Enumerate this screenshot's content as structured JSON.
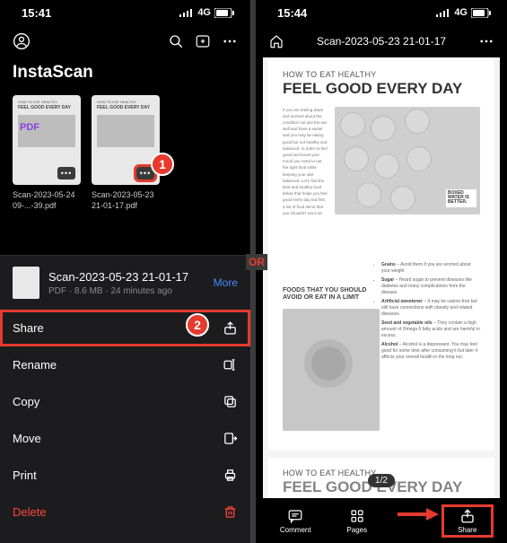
{
  "or_divider": "OR",
  "left": {
    "status": {
      "time": "15:41",
      "network": "4G"
    },
    "app_title": "InstaScan",
    "docs": [
      {
        "name": "Scan-2023-05-24 09-...-39.pdf",
        "thumb_head": "FEEL GOOD EVERY DAY",
        "thumb_sub": "HOW TO EAT HEALTHY",
        "pdf_badge": "PDF"
      },
      {
        "name": "Scan-2023-05-23 21-01-17.pdf",
        "thumb_head": "FEEL GOOD EVERY DAY",
        "thumb_sub": "HOW TO EAT HEALTHY"
      }
    ],
    "badge1": "1",
    "badge2": "2",
    "sheet": {
      "title": "Scan-2023-05-23 21-01-17",
      "meta": "PDF · 8.6 MB · 24 minutes ago",
      "more": "More",
      "rows": {
        "share": "Share",
        "rename": "Rename",
        "copy": "Copy",
        "move": "Move",
        "print": "Print",
        "delete": "Delete"
      }
    }
  },
  "right": {
    "status": {
      "time": "15:44",
      "network": "4G"
    },
    "title": "Scan-2023-05-23 21-01-17",
    "page_counter": "1/2",
    "doc": {
      "subhead": "HOW TO EAT HEALTHY",
      "headline": "FEEL GOOD EVERY DAY",
      "para": "If you are feeling down and worried about the condition not just the eat well and have a easier and you may be eating good but not healthy and balanced. In order to feel good and boost your mood you need to eat the right food while keeping your diet balanced. Let's find the best and healthy food below that helps you feel good every day but first, a list of food items that you shouldn't eat a lot.",
      "boxed": "BOXED WATER IS BETTER.",
      "section2": "FOODS THAT YOU SHOULD AVOID OR EAT IN A LIMIT",
      "bullets": [
        {
          "b": "Grains",
          "t": "– Avoid them if you are worried about your weight"
        },
        {
          "b": "Sugar",
          "t": "– Heard sugar to prevent diseases like diabetes and many complications from the disease."
        },
        {
          "b": "Artificial sweetener",
          "t": "– It may be calorie-free but still have connections with obesity and related diseases."
        },
        {
          "b": "Seed and vegetable oils",
          "t": "– They contain a high amount of Omega 6 fatty acids and are harmful in excess."
        },
        {
          "b": "Alcohol",
          "t": "– Alcohol is a depressant. You may feel good for some time after consuming it but later it affects your overall health in the long run."
        }
      ]
    },
    "tabs": {
      "comment": "Comment",
      "pages": "Pages",
      "share": "Share"
    }
  }
}
